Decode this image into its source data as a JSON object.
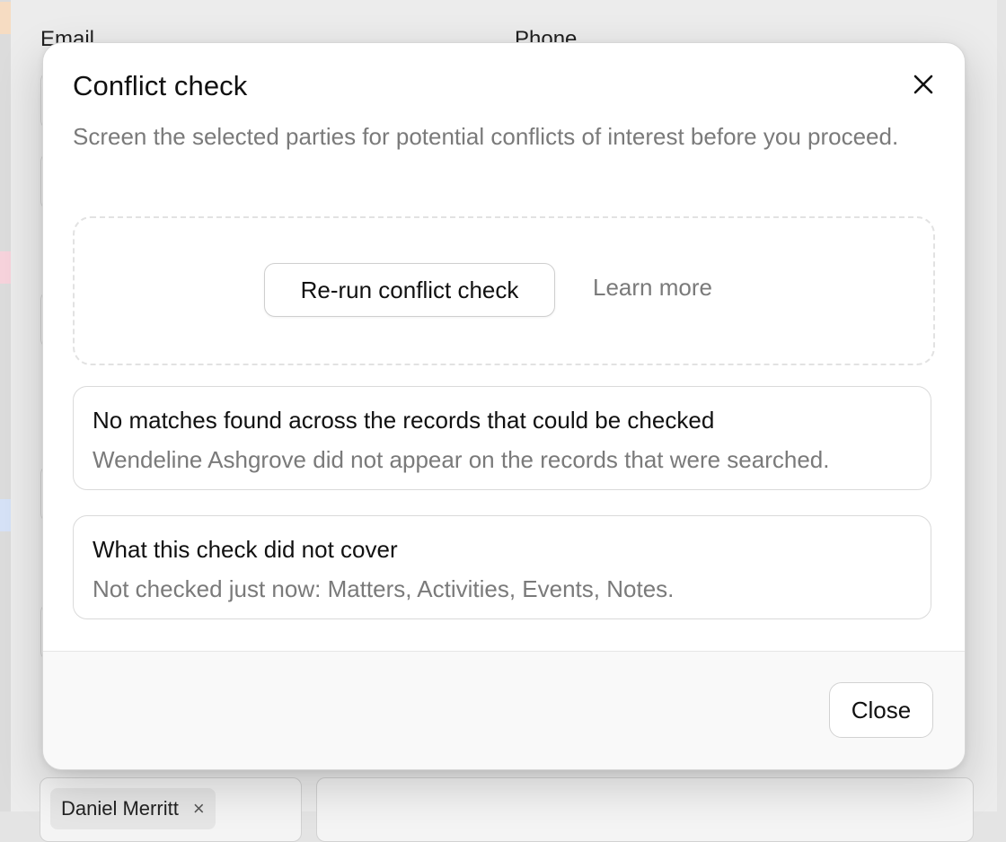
{
  "background": {
    "labels": {
      "email": "Email",
      "phone": "Phone"
    },
    "chip": {
      "name": "Daniel Merritt",
      "remove_glyph": "×"
    }
  },
  "modal": {
    "title": "Conflict check",
    "close_icon": "close-icon",
    "description": "Screen the selected parties for potential conflicts of interest before you proceed.",
    "actions": {
      "rerun_label": "Re-run conflict check",
      "learn_more_label": "Learn more"
    },
    "cards": [
      {
        "title": "No matches found across the records that could be checked",
        "text": "Wendeline Ashgrove did not appear on the records that were searched."
      },
      {
        "title": "What this check did not cover",
        "text": "Not checked just now: Matters, Activities, Events, Notes."
      }
    ],
    "footer": {
      "close_label": "Close"
    }
  },
  "colors": {
    "overlay": "#e4e4e4",
    "text_primary": "#111111",
    "text_muted": "#7a7a7a",
    "border": "#dadada"
  }
}
